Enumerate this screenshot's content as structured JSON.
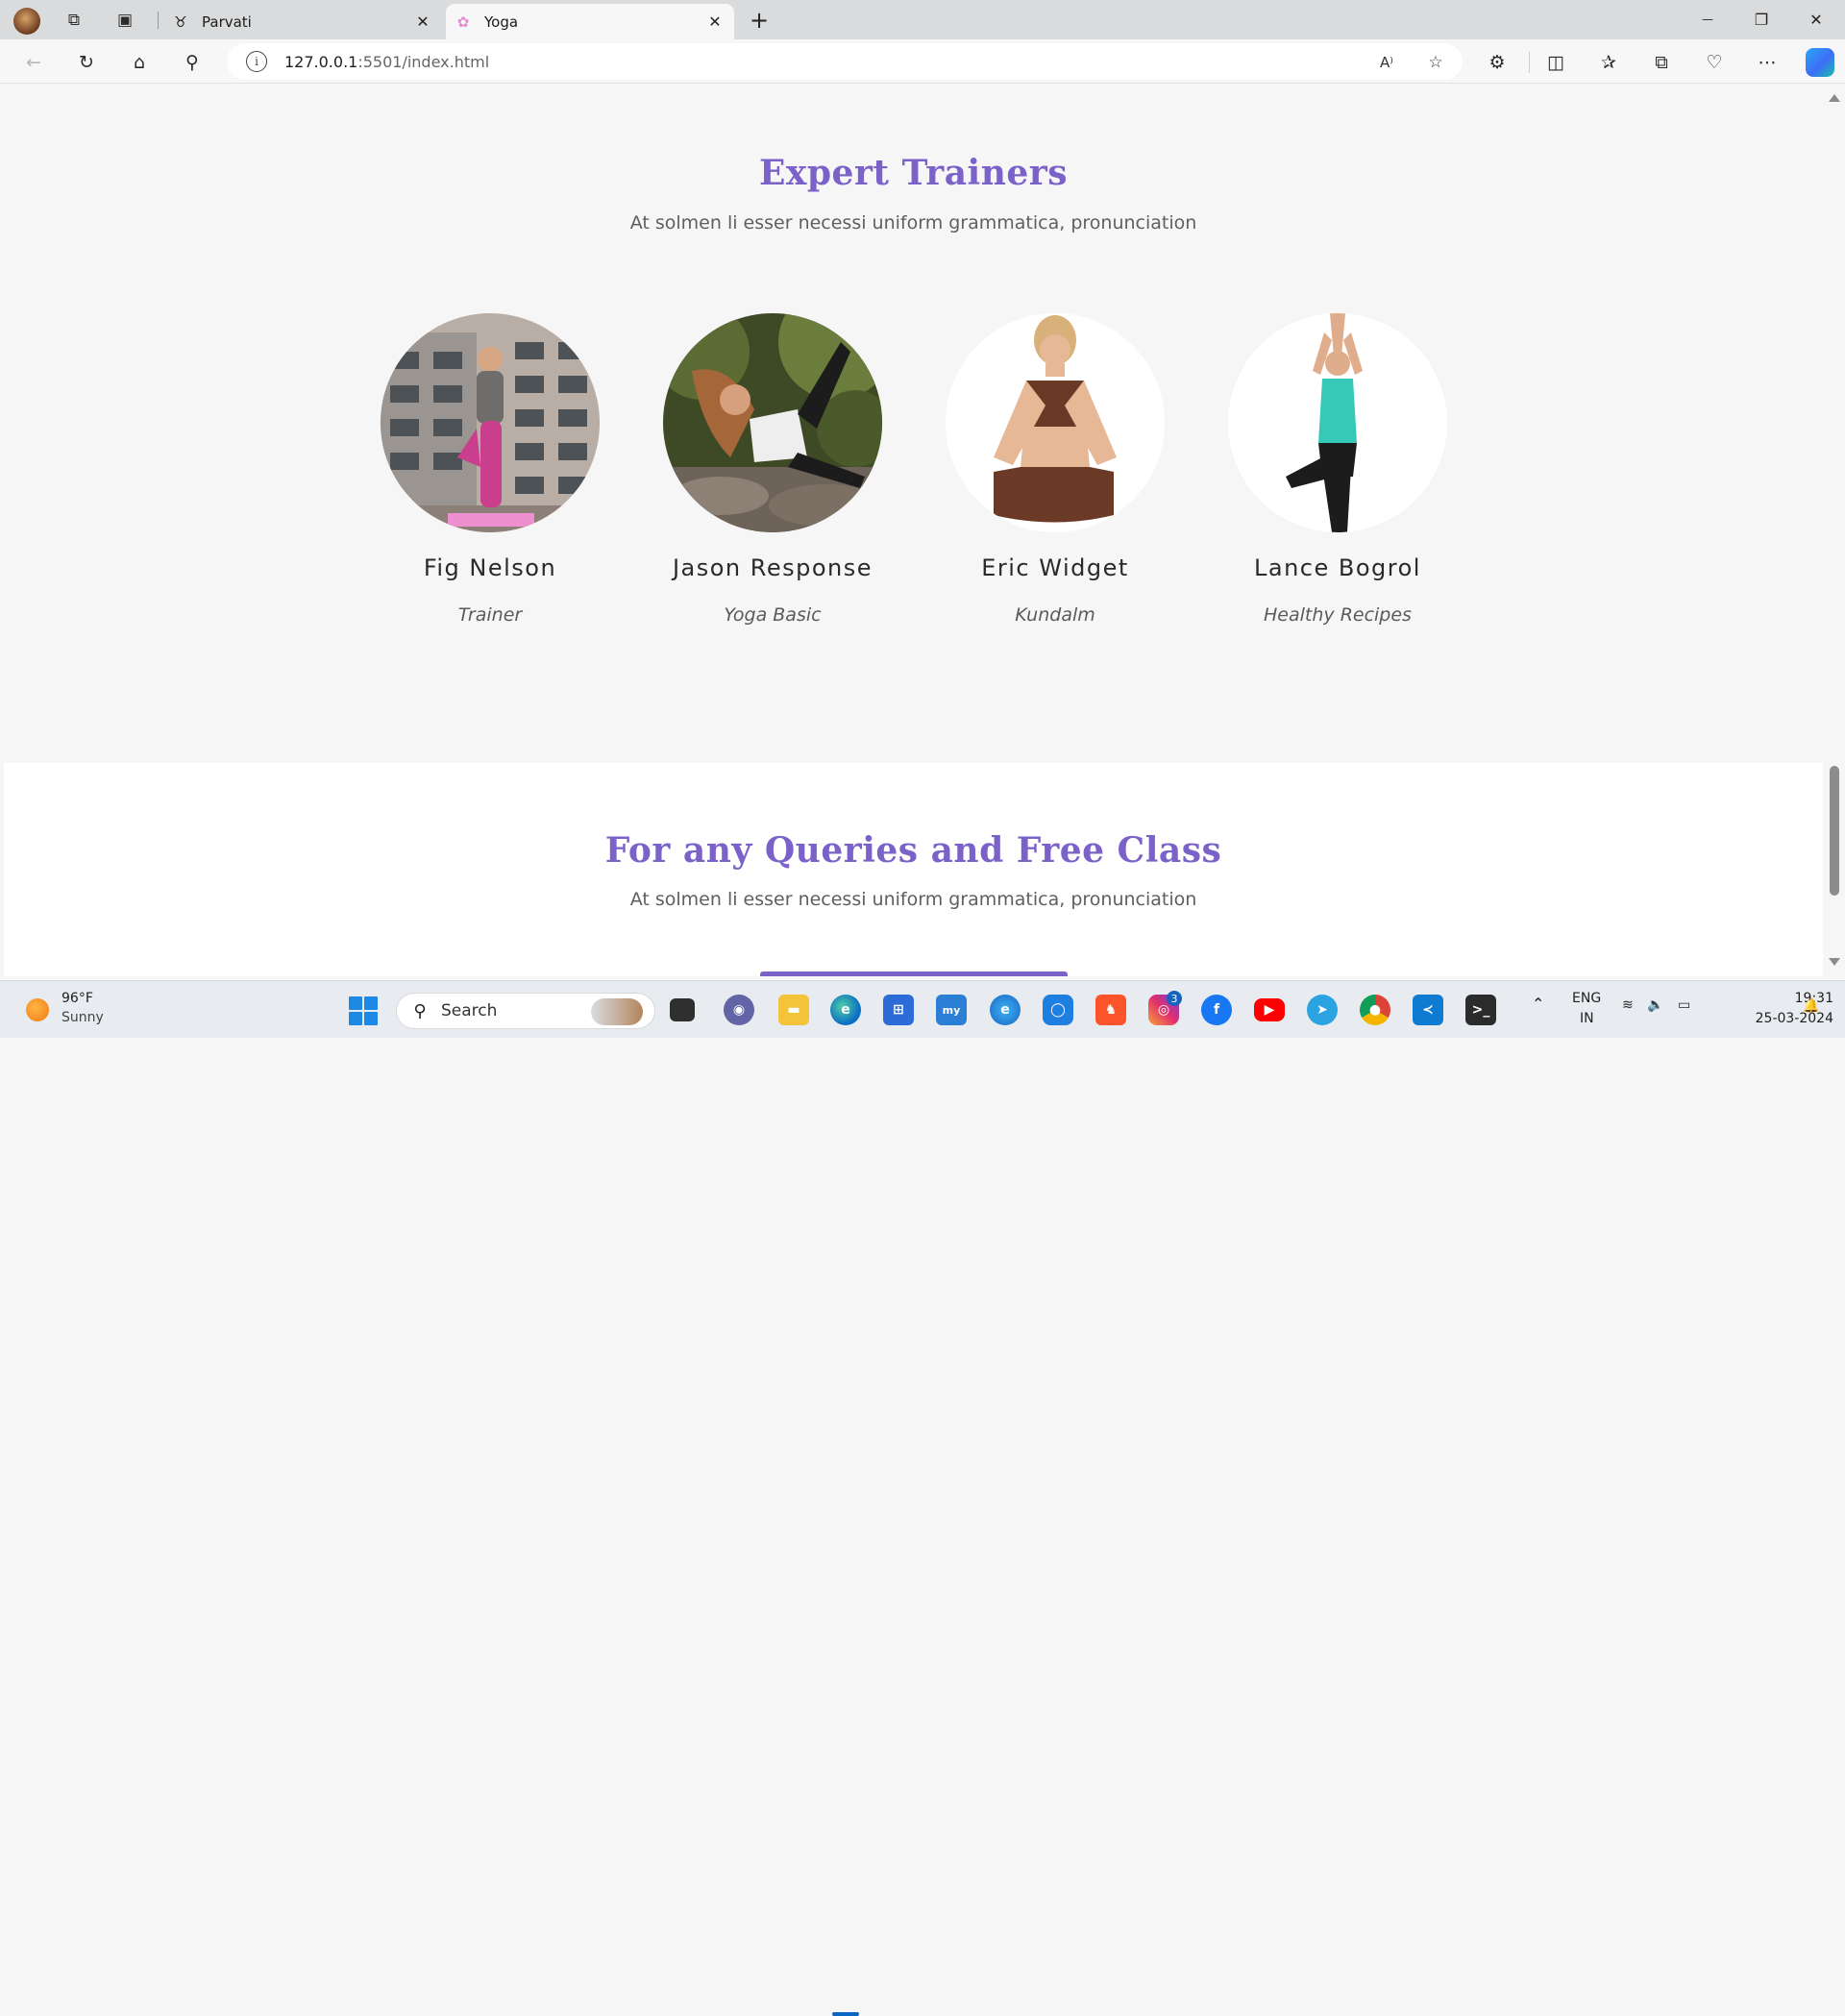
{
  "browser": {
    "tabs": [
      {
        "title": "Parvati",
        "active": false,
        "favicon": "cat-icon"
      },
      {
        "title": "Yoga",
        "active": true,
        "favicon": "lotus-icon"
      }
    ],
    "close_glyph": "✕",
    "new_tab_glyph": "+",
    "window_controls": {
      "minimize": "—",
      "maximize": "❐",
      "close": "✕"
    },
    "address": {
      "host": "127.0.0.1",
      "rest": ":5501/index.html"
    },
    "toolbar_icons": [
      "back-icon",
      "refresh-icon",
      "home-icon",
      "search-icon",
      "info-icon",
      "read-aloud-icon",
      "favorite-star-icon",
      "extensions-icon",
      "split-screen-icon",
      "favorites-icon",
      "collections-icon",
      "browser-essentials-icon",
      "more-icon",
      "copilot-icon"
    ]
  },
  "page": {
    "trainers_section": {
      "title": "Expert Trainers",
      "subtitle": "At solmen li esser necessi uniform grammatica, pronunciation",
      "trainers": [
        {
          "name": "Fig Nelson",
          "role": "Trainer"
        },
        {
          "name": "Jason Response",
          "role": "Yoga Basic"
        },
        {
          "name": "Eric Widget",
          "role": "Kundalm"
        },
        {
          "name": "Lance Bogrol",
          "role": "Healthy Recipes"
        }
      ]
    },
    "queries_section": {
      "title": "For any Queries and Free Class",
      "subtitle": "At solmen li esser necessi uniform grammatica, pronunciation"
    }
  },
  "taskbar": {
    "weather": {
      "temp": "96°F",
      "desc": "Sunny"
    },
    "search_label": "Search",
    "instagram_badge": "3",
    "tray": {
      "lang_top": "ENG",
      "lang_bottom": "IN"
    },
    "clock": {
      "time": "19:31",
      "date": "25-03-2024"
    },
    "colors": {
      "accent": "#7b62c9",
      "taskbar_bg": "#e8ebef"
    }
  }
}
